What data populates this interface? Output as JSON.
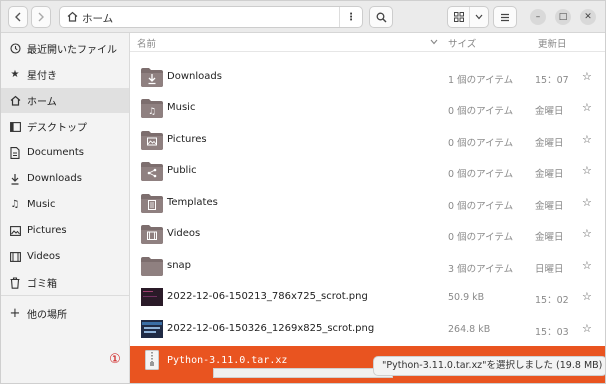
{
  "header": {
    "path_label": "ホーム"
  },
  "sidebar": {
    "items": [
      {
        "label": "最近開いたファイル",
        "icon": "clock-icon"
      },
      {
        "label": "星付き",
        "icon": "star-icon"
      },
      {
        "label": "ホーム",
        "icon": "home-icon"
      },
      {
        "label": "デスクトップ",
        "icon": "desktop-icon"
      },
      {
        "label": "Documents",
        "icon": "document-icon"
      },
      {
        "label": "Downloads",
        "icon": "download-icon"
      },
      {
        "label": "Music",
        "icon": "music-icon"
      },
      {
        "label": "Pictures",
        "icon": "picture-icon"
      },
      {
        "label": "Videos",
        "icon": "video-icon"
      },
      {
        "label": "ゴミ箱",
        "icon": "trash-icon"
      }
    ],
    "other_places": "他の場所"
  },
  "columns": {
    "name": "名前",
    "size": "サイズ",
    "modified": "更新日"
  },
  "files": [
    {
      "name": "Downloads",
      "size": "1 個のアイテム",
      "modified": "15：07",
      "type": "folder",
      "icon": "download-icon"
    },
    {
      "name": "Music",
      "size": "0 個のアイテム",
      "modified": "金曜日",
      "type": "folder",
      "icon": "music-icon"
    },
    {
      "name": "Pictures",
      "size": "0 個のアイテム",
      "modified": "金曜日",
      "type": "folder",
      "icon": "picture-icon"
    },
    {
      "name": "Public",
      "size": "0 個のアイテム",
      "modified": "金曜日",
      "type": "folder",
      "icon": "share-icon"
    },
    {
      "name": "Templates",
      "size": "0 個のアイテム",
      "modified": "金曜日",
      "type": "folder",
      "icon": "template-icon"
    },
    {
      "name": "Videos",
      "size": "0 個のアイテム",
      "modified": "金曜日",
      "type": "folder",
      "icon": "video-icon"
    },
    {
      "name": "snap",
      "size": "3 個のアイテム",
      "modified": "日曜日",
      "type": "folder",
      "icon": "folder-icon"
    },
    {
      "name": "2022-12-06-150213_786x725_scrot.png",
      "size": "50.9 kB",
      "modified": "15：02",
      "type": "image",
      "icon": "image-thumbnail"
    },
    {
      "name": "2022-12-06-150326_1269x825_scrot.png",
      "size": "264.8 kB",
      "modified": "15：03",
      "type": "image",
      "icon": "image-thumbnail"
    }
  ],
  "selected_file": {
    "name": "Python-3.11.0.tar.xz",
    "icon": "archive-icon"
  },
  "annotation_marker": "①",
  "status_toast": "\"Python-3.11.0.tar.xz\"を選択しました (19.8 MB)",
  "accent_color": "#e95420"
}
